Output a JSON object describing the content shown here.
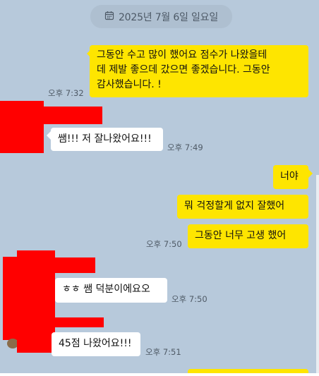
{
  "date_divider": {
    "label": "2025년 7월 6일 일요일",
    "icon": "calendar-icon"
  },
  "messages": [
    {
      "from": "me",
      "text": "그동안 수고 많이 했어요 점수가 나왔을테\n데 제발 좋으데 갔으면 좋겠습니다. 그동안\n감사했습니다. !",
      "time": "오후 7:32"
    },
    {
      "from": "other",
      "text": "쌤!!! 저 잘나왔어요!!!",
      "time": "오후 7:49"
    },
    {
      "from": "me",
      "text": "너야",
      "time": ""
    },
    {
      "from": "me",
      "text": "뭐 걱정할게 없지 잘했어",
      "time": ""
    },
    {
      "from": "me",
      "text": "그동안 너무 고생 했어",
      "time": "오후 7:50"
    },
    {
      "from": "other",
      "text": "ㅎㅎ 쌤 덕분이에요오",
      "time": "오후 7:50"
    },
    {
      "from": "other",
      "text": "45점 나왔어요!!!",
      "time": "오후 7:51"
    }
  ],
  "colors": {
    "background": "#b7c9db",
    "my_bubble": "#fee500",
    "other_bubble": "#ffffff",
    "redaction": "#ff0000"
  }
}
